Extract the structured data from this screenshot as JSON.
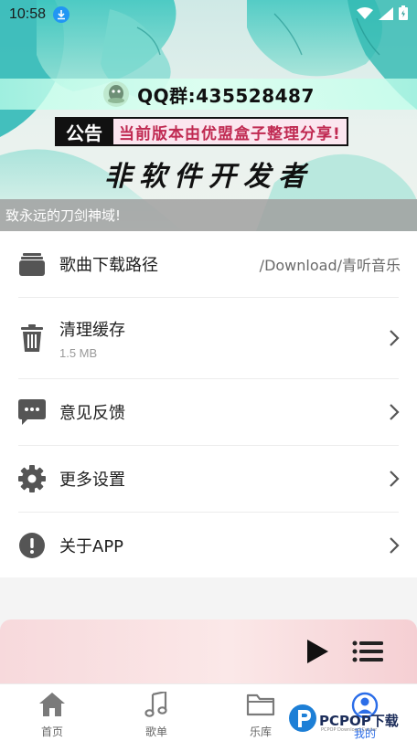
{
  "status_bar": {
    "time": "10:58"
  },
  "banner": {
    "qq_text": "QQ群:435528487",
    "notice_tag": "公告",
    "notice_text": "当前版本由优盟盒子整理分享!",
    "developer_text": "非软件开发者",
    "ticker_text": "致永远的刀剑神域!"
  },
  "settings": {
    "download_path": {
      "label": "歌曲下载路径",
      "value": "/Download/青听音乐",
      "icon": "folder-stack-icon"
    },
    "clear_cache": {
      "label": "清理缓存",
      "sub": "1.5 MB",
      "icon": "trash-icon"
    },
    "feedback": {
      "label": "意见反馈",
      "icon": "chat-bubble-icon"
    },
    "more_settings": {
      "label": "更多设置",
      "icon": "gear-icon"
    },
    "about": {
      "label": "关于APP",
      "icon": "exclamation-circle-icon"
    }
  },
  "player": {
    "play_icon": "play-icon",
    "playlist_icon": "playlist-icon"
  },
  "bottom_nav": {
    "tabs": [
      {
        "label": "首页",
        "icon": "home-icon"
      },
      {
        "label": "歌单",
        "icon": "music-note-icon"
      },
      {
        "label": "乐库",
        "icon": "folder-icon"
      },
      {
        "label": "我的",
        "icon": "person-circle-icon",
        "active": true
      }
    ]
  },
  "watermark": {
    "text": "PCPOP下载",
    "small_text": "PCPOP Download Center"
  },
  "colors": {
    "accent_blue": "#2b6de8",
    "notice_red": "#c02a52",
    "player_pink": "#f7d9dc"
  }
}
